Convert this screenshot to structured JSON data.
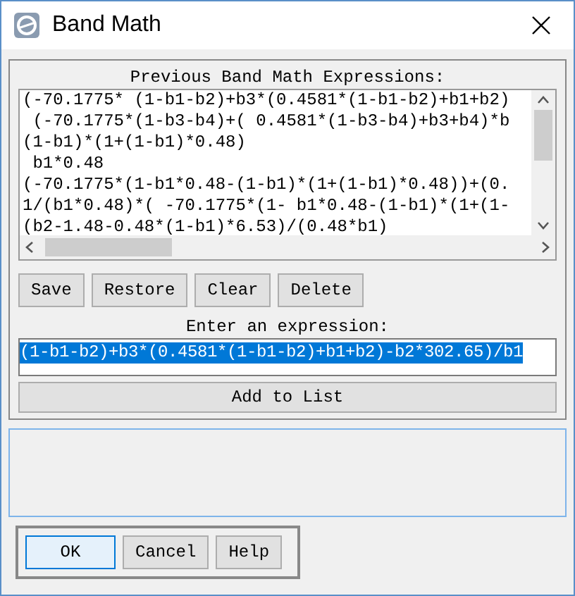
{
  "window": {
    "title": "Band Math"
  },
  "history": {
    "label": "Previous Band Math Expressions:",
    "lines": [
      "(-70.1775* (1-b1-b2)+b3*(0.4581*(1-b1-b2)+b1+b2)",
      " (-70.1775*(1-b3-b4)+( 0.4581*(1-b3-b4)+b3+b4)*b",
      "(1-b1)*(1+(1-b1)*0.48)",
      " b1*0.48",
      "(-70.1775*(1-b1*0.48-(1-b1)*(1+(1-b1)*0.48))+(0.",
      "1/(b1*0.48)*( -70.1775*(1- b1*0.48-(1-b1)*(1+(1-",
      "(b2-1.48-0.48*(1-b1)*6.53)/(0.48*b1)"
    ]
  },
  "history_buttons": [
    "Save",
    "Restore",
    "Clear",
    "Delete"
  ],
  "expression": {
    "label": "Enter an expression:",
    "value": "(1-b1-b2)+b3*(0.4581*(1-b1-b2)+b1+b2)-b2*302.65)/b1",
    "selected": true
  },
  "add_button": "Add to List",
  "dialog_buttons": [
    {
      "label": "OK",
      "selected": true
    },
    {
      "label": "Cancel",
      "selected": false
    },
    {
      "label": "Help",
      "selected": false
    }
  ]
}
